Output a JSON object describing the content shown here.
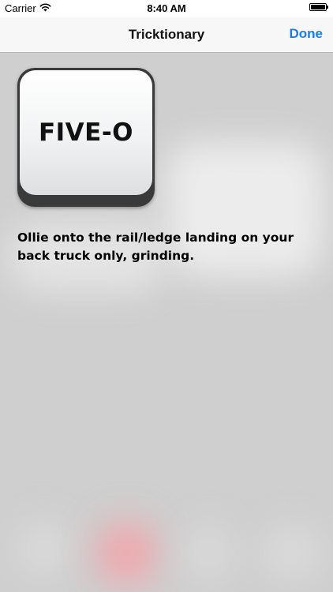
{
  "status_bar": {
    "carrier": "Carrier",
    "time": "8:40 AM",
    "icons": [
      "wifi-icon",
      "battery-icon"
    ]
  },
  "nav": {
    "title": "Tricktionary",
    "done_label": "Done"
  },
  "trick": {
    "name": "FIVE-O",
    "description": "Ollie onto the rail/ledge landing on your back truck only, grinding."
  },
  "colors": {
    "accent": "#1a7ee6",
    "background": "#cfcfcf",
    "nav_background": "#f7f7f7",
    "key_border": "#3a3a3a"
  }
}
